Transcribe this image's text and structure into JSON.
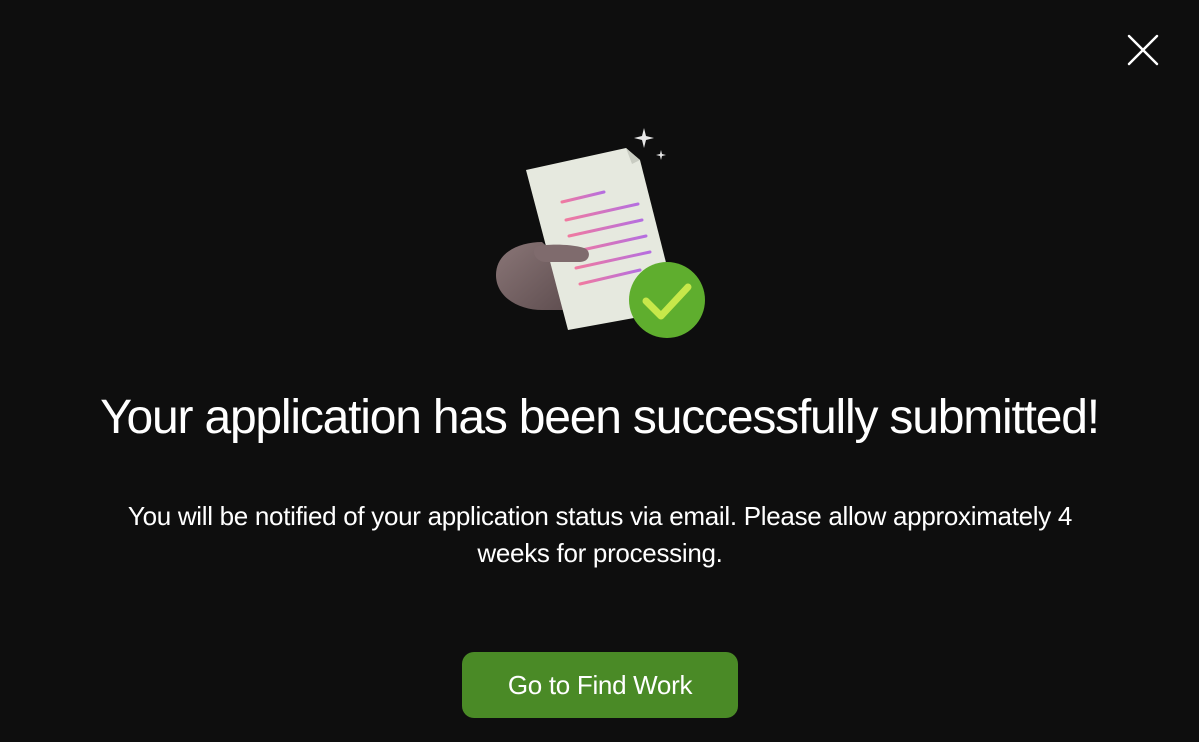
{
  "dialog": {
    "close_icon": "close-icon",
    "illustration_icons": [
      "hand-icon",
      "document-icon",
      "check-circle-icon",
      "sparkle-icon"
    ],
    "title": "Your application has been successfully submitted!",
    "message": "You will be notified of your application status via email. Please allow approximately 4 weeks for processing.",
    "cta_label": "Go to Find Work"
  },
  "colors": {
    "background": "#0e0e0e",
    "text": "#ffffff",
    "accent": "#4a8a26",
    "check": "#5fae2e"
  }
}
